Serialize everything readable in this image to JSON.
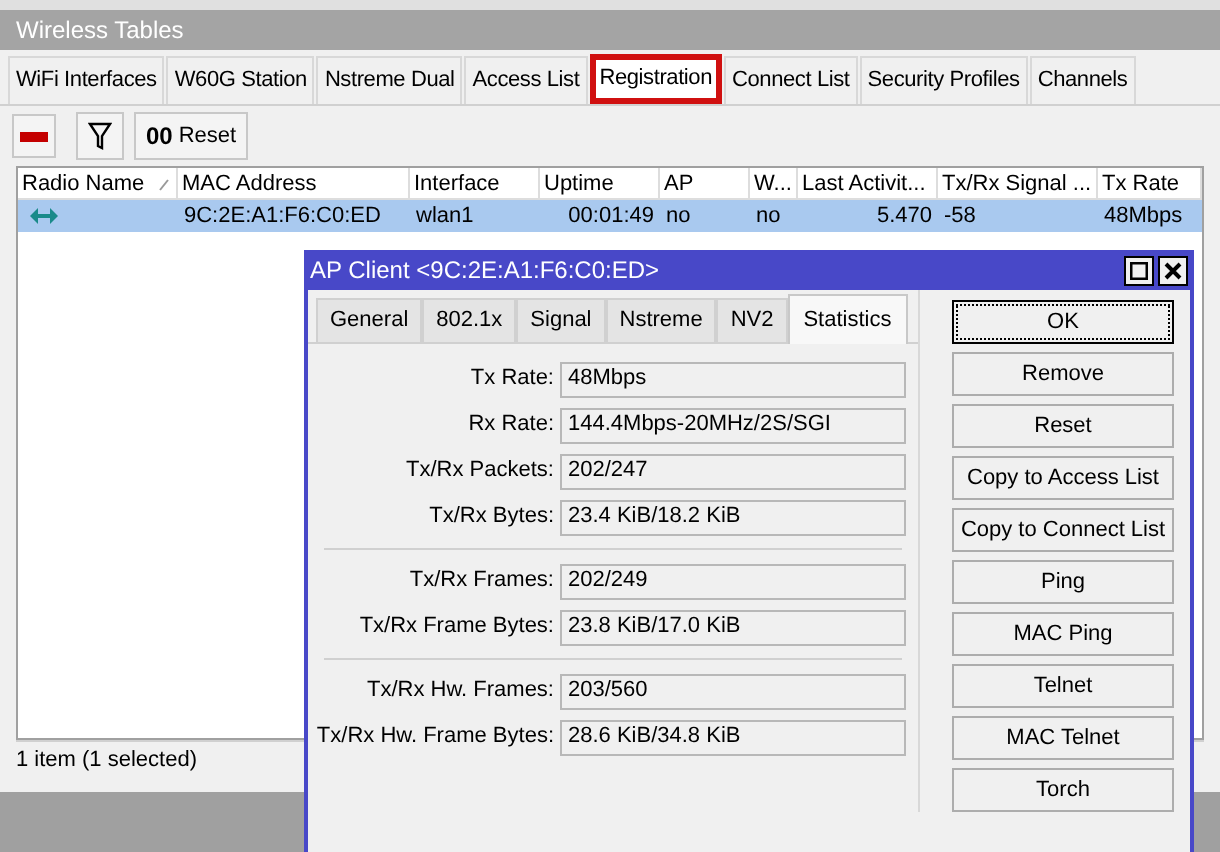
{
  "window": {
    "title": "Wireless Tables"
  },
  "tabs": [
    {
      "label": "WiFi Interfaces",
      "selected": false
    },
    {
      "label": "W60G Station",
      "selected": false
    },
    {
      "label": "Nstreme Dual",
      "selected": false
    },
    {
      "label": "Access List",
      "selected": false
    },
    {
      "label": "Registration",
      "selected": true
    },
    {
      "label": "Connect List",
      "selected": false
    },
    {
      "label": "Security Profiles",
      "selected": false
    },
    {
      "label": "Channels",
      "selected": false
    }
  ],
  "toolbar": {
    "reset_button": {
      "icon_text": "00",
      "label": "Reset"
    }
  },
  "table": {
    "columns": [
      {
        "label": "Radio Name",
        "sorted": true
      },
      {
        "label": "MAC Address",
        "sorted": false
      },
      {
        "label": "Interface",
        "sorted": false
      },
      {
        "label": "Uptime",
        "sorted": false
      },
      {
        "label": "AP",
        "sorted": false
      },
      {
        "label": "W...",
        "sorted": false
      },
      {
        "label": "Last Activit...",
        "sorted": false
      },
      {
        "label": "Tx/Rx Signal ...",
        "sorted": false
      },
      {
        "label": "Tx Rate",
        "sorted": false
      }
    ],
    "rows": [
      {
        "selected": true,
        "cells": [
          "",
          "9C:2E:A1:F6:C0:ED",
          "wlan1",
          "00:01:49",
          "no",
          "no",
          "5.470",
          "-58",
          "48Mbps"
        ]
      }
    ]
  },
  "status_bar": "1 item (1 selected)",
  "dialog": {
    "title": "AP Client <9C:2E:A1:F6:C0:ED>",
    "tabs": [
      {
        "label": "General",
        "selected": false
      },
      {
        "label": "802.1x",
        "selected": false
      },
      {
        "label": "Signal",
        "selected": false
      },
      {
        "label": "Nstreme",
        "selected": false
      },
      {
        "label": "NV2",
        "selected": false
      },
      {
        "label": "Statistics",
        "selected": true
      }
    ],
    "groups": [
      [
        {
          "label": "Tx Rate:",
          "value": "48Mbps"
        },
        {
          "label": "Rx Rate:",
          "value": "144.4Mbps-20MHz/2S/SGI"
        },
        {
          "label": "Tx/Rx Packets:",
          "value": "202/247"
        },
        {
          "label": "Tx/Rx Bytes:",
          "value": "23.4 KiB/18.2 KiB"
        }
      ],
      [
        {
          "label": "Tx/Rx Frames:",
          "value": "202/249"
        },
        {
          "label": "Tx/Rx Frame Bytes:",
          "value": "23.8 KiB/17.0 KiB"
        }
      ],
      [
        {
          "label": "Tx/Rx Hw. Frames:",
          "value": "203/560"
        },
        {
          "label": "Tx/Rx Hw. Frame Bytes:",
          "value": "28.6 KiB/34.8 KiB"
        }
      ]
    ],
    "buttons": [
      {
        "label": "OK",
        "focused": true
      },
      {
        "label": "Remove",
        "focused": false
      },
      {
        "label": "Reset",
        "focused": false
      },
      {
        "label": "Copy to Access List",
        "focused": false
      },
      {
        "label": "Copy to Connect List",
        "focused": false
      },
      {
        "label": "Ping",
        "focused": false
      },
      {
        "label": "MAC Ping",
        "focused": false
      },
      {
        "label": "Telnet",
        "focused": false
      },
      {
        "label": "MAC Telnet",
        "focused": false
      },
      {
        "label": "Torch",
        "focused": false
      }
    ]
  }
}
